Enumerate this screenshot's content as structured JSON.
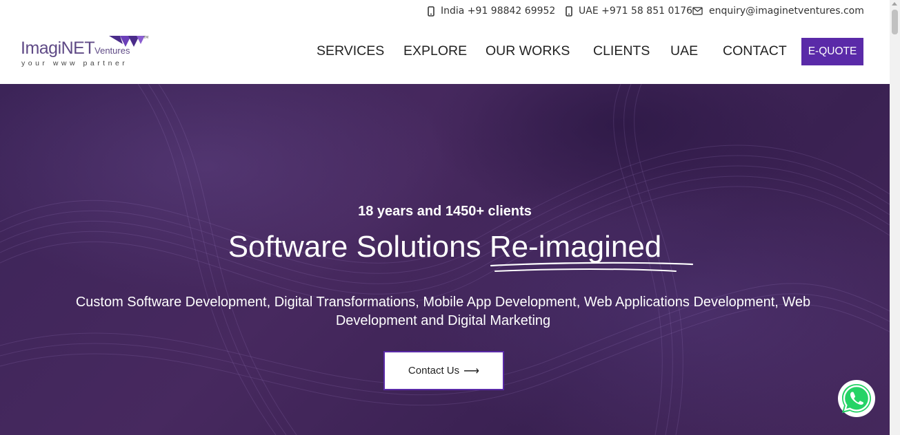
{
  "topbar": {
    "india_phone": "India +91 98842 69952",
    "uae_phone": "UAE +971 58 851 0176",
    "email": "enquiry@imaginetventures.com"
  },
  "logo": {
    "main": "ImagiNET",
    "small": "Ventures",
    "tagline": "your www partner"
  },
  "nav": {
    "items": [
      "SERVICES",
      "EXPLORE",
      "OUR WORKS",
      "CLIENTS",
      "UAE",
      "CONTACT"
    ],
    "cta": "E-QUOTE"
  },
  "hero": {
    "subtitle": "18 years and 1450+ clients",
    "title_prefix": "Software Solutions",
    "title_highlight": "Re-imagined",
    "description": "Custom Software Development, Digital Transformations, Mobile App Development, Web Applications Development, Web Development and Digital Marketing",
    "cta_label": "Contact Us",
    "cta_arrow": "⟶"
  },
  "icons": {
    "phone": "phone-icon",
    "email": "envelope-icon",
    "whatsapp": "whatsapp-icon"
  },
  "colors": {
    "brand_purple": "#5a2aa8",
    "hero_bg": "#3c2458",
    "whatsapp_green": "#25d366"
  }
}
